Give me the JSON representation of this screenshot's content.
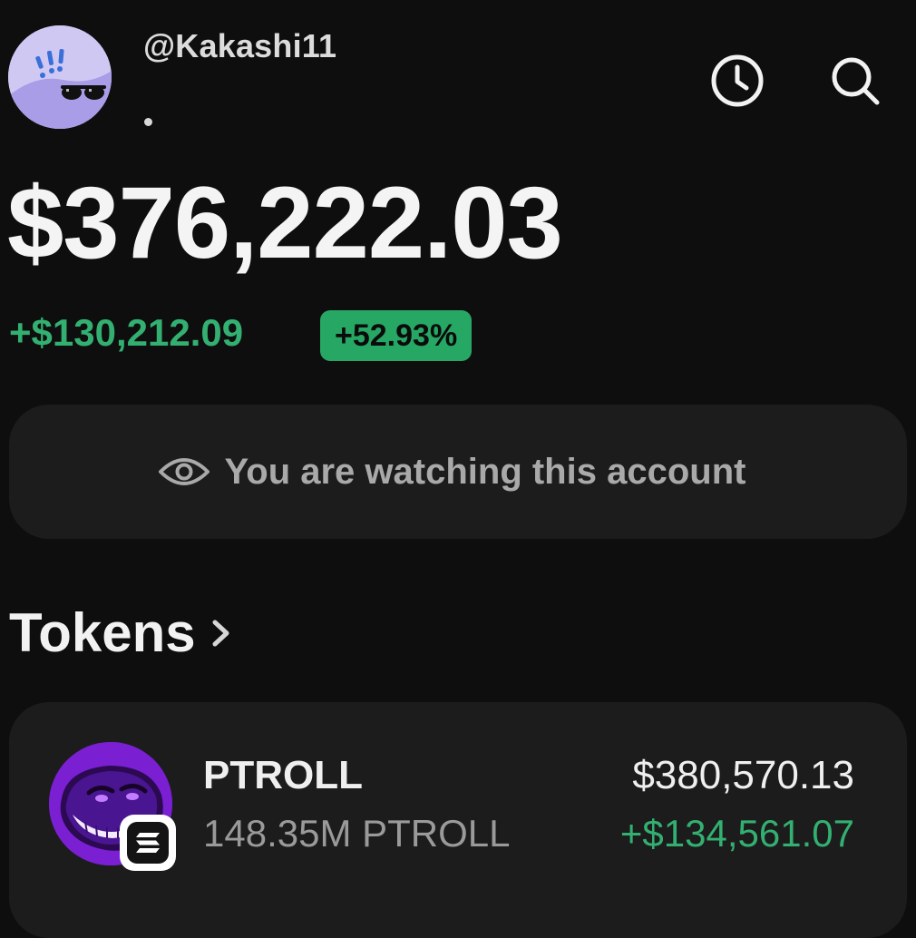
{
  "header": {
    "username": "@Kakashi11",
    "avatar_icon": "sunglasses-exclaim-avatar",
    "history_icon": "clock-icon",
    "search_icon": "search-icon"
  },
  "balance": {
    "total": "$376,222.03",
    "change_amount": "+$130,212.09",
    "change_percent": "+52.93%"
  },
  "watch_banner": {
    "icon": "eye-icon",
    "text": "You are watching this account"
  },
  "tokens_section": {
    "title": "Tokens",
    "chevron_icon": "chevron-right-icon"
  },
  "tokens": [
    {
      "name": "PTROLL",
      "amount": "148.35M PTROLL",
      "value": "$380,570.13",
      "change": "+$134,561.07",
      "logo_icon": "troll-face-logo",
      "chain_icon": "solana-chain-icon"
    }
  ],
  "colors": {
    "background": "#0e0e0e",
    "card": "#1c1c1c",
    "positive": "#33b071",
    "badge": "#27a764",
    "token_logo": "#7a1fd1"
  }
}
